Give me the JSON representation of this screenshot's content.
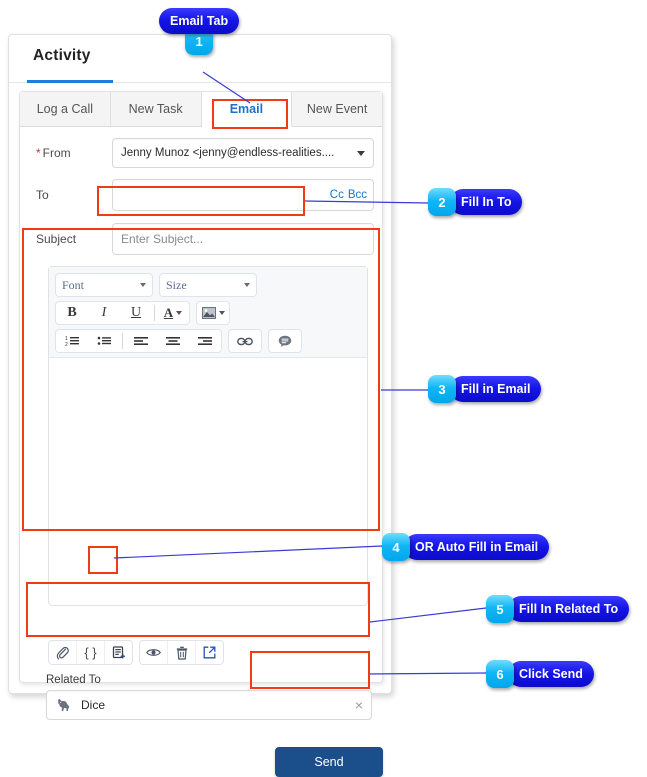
{
  "panel": {
    "section_title": "Activity",
    "tabs": [
      {
        "label": "Log a Call",
        "active": false
      },
      {
        "label": "New Task",
        "active": false
      },
      {
        "label": "Email",
        "active": true
      },
      {
        "label": "New Event",
        "active": false
      }
    ]
  },
  "form": {
    "from": {
      "label": "From",
      "required_marker": "*",
      "value": "Jenny Munoz <jenny@endless-realities....",
      "caret_icon": "chevron-down-icon"
    },
    "to": {
      "label": "To",
      "value": "",
      "placeholder": "",
      "cc_label": "Cc",
      "bcc_label": "Bcc"
    },
    "subject": {
      "label": "Subject",
      "value": "",
      "placeholder": "Enter Subject..."
    },
    "body": {
      "value": ""
    },
    "related_to": {
      "label": "Related To",
      "value": "Dice",
      "record_icon": "dog-record-icon",
      "clear_icon": "close-icon",
      "clear_label": "×"
    },
    "send_button": "Send"
  },
  "editor_toolbar": {
    "row1": [
      {
        "name": "font-family-select",
        "label": "Font",
        "caret_icon": "chevron-down-icon"
      },
      {
        "name": "font-size-select",
        "label": "Size",
        "caret_icon": "chevron-down-icon"
      }
    ],
    "row2": [
      {
        "name": "bold-button",
        "glyph": "B",
        "icon": "bold-icon"
      },
      {
        "name": "italic-button",
        "glyph": "I",
        "icon": "italic-icon"
      },
      {
        "name": "underline-button",
        "glyph": "U",
        "icon": "underline-icon"
      },
      {
        "name": "font-color-button",
        "glyph": "A",
        "icon": "font-color-icon"
      },
      {
        "name": "insert-image-button",
        "glyph": "⬚",
        "icon": "image-icon"
      }
    ],
    "row3": [
      {
        "name": "numbered-list-button",
        "icon": "ordered-list-icon"
      },
      {
        "name": "bulleted-list-button",
        "icon": "bulleted-list-icon"
      },
      {
        "name": "align-left-button",
        "icon": "align-left-icon"
      },
      {
        "name": "align-center-button",
        "icon": "align-center-icon"
      },
      {
        "name": "align-right-button",
        "icon": "align-right-icon"
      },
      {
        "name": "insert-link-button",
        "icon": "link-icon"
      },
      {
        "name": "quote-button",
        "icon": "speech-bubble-icon"
      }
    ]
  },
  "action_toolbar": {
    "left_group": [
      {
        "name": "attach-file-button",
        "icon": "paperclip-icon"
      },
      {
        "name": "merge-field-button",
        "icon": "braces-icon",
        "glyph": "{ }"
      },
      {
        "name": "insert-template-button",
        "icon": "template-add-icon"
      }
    ],
    "right_group": [
      {
        "name": "preview-button",
        "icon": "eye-icon"
      },
      {
        "name": "delete-draft-button",
        "icon": "trash-icon"
      },
      {
        "name": "popout-button",
        "icon": "external-link-icon"
      }
    ]
  },
  "callouts": [
    {
      "number": "1",
      "label": "Email Tab",
      "layout": "stacked"
    },
    {
      "number": "2",
      "label": "Fill In To",
      "layout": "inline"
    },
    {
      "number": "3",
      "label": "Fill in Email",
      "layout": "inline"
    },
    {
      "number": "4",
      "label": "OR Auto Fill in Email",
      "layout": "inline"
    },
    {
      "number": "5",
      "label": "Fill In Related To",
      "layout": "inline"
    },
    {
      "number": "6",
      "label": "Click Send",
      "layout": "inline"
    }
  ],
  "colors": {
    "highlight_box": "#f03c12",
    "callout_pill": "#1414e6",
    "callout_badge": "#12b6f5",
    "leader_line": "#3a3ad8",
    "active_tab_text": "#1a73c8",
    "send_button_bg": "#1b4f8c",
    "section_underline": "#1b7fe0",
    "link_text": "#1a73c8"
  }
}
